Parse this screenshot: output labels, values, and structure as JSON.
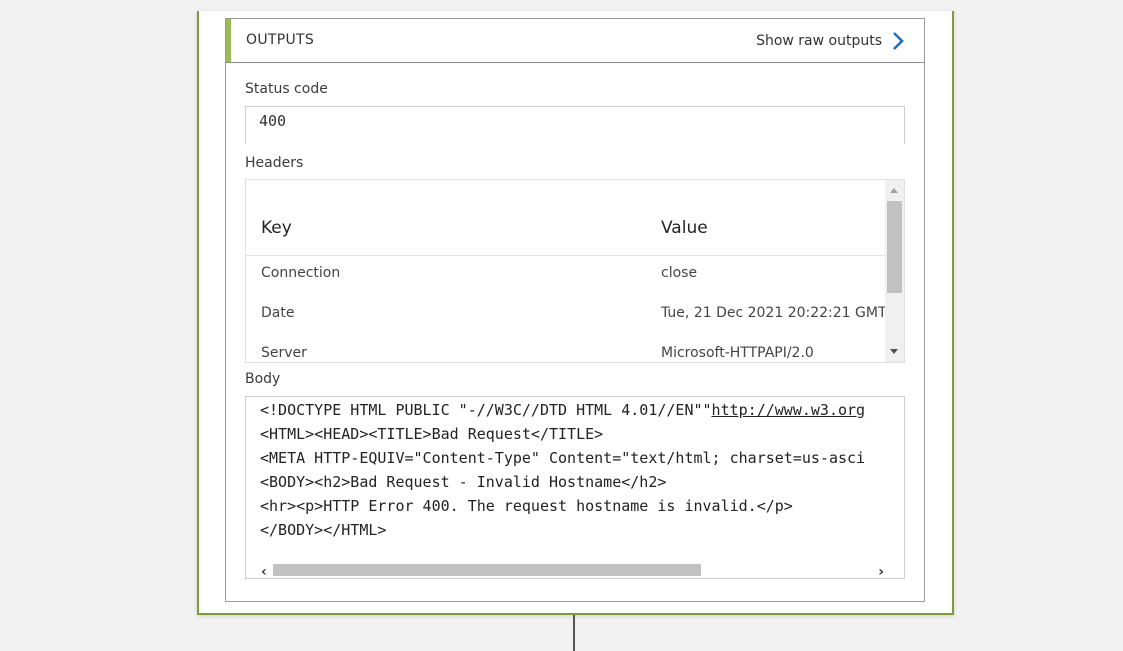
{
  "panel": {
    "title": "OUTPUTS",
    "raw_link_label": "Show raw outputs"
  },
  "status": {
    "label": "Status code",
    "value": "400"
  },
  "headers": {
    "label": "Headers",
    "columns": [
      "Key",
      "Value"
    ],
    "rows": [
      {
        "key": "Connection",
        "value": "close"
      },
      {
        "key": "Date",
        "value": "Tue, 21 Dec 2021 20:22:21 GMT"
      },
      {
        "key": "Server",
        "value": "Microsoft-HTTPAPI/2.0"
      }
    ]
  },
  "body": {
    "label": "Body",
    "lines": [
      "<!DOCTYPE HTML PUBLIC \"-//W3C//DTD HTML 4.01//EN\"\"",
      "<HTML><HEAD><TITLE>Bad Request</TITLE>",
      "<META HTTP-EQUIV=\"Content-Type\" Content=\"text/html; charset=us-asci",
      "<BODY><h2>Bad Request - Invalid Hostname</h2>",
      "<hr><p>HTTP Error 400. The request hostname is invalid.</p>",
      "</BODY></HTML>"
    ],
    "line1_link": "http://www.w3.org"
  },
  "colors": {
    "card_border": "#7a9f3a",
    "header_accent": "#9bbb59",
    "chevron": "#1f6fbf"
  }
}
